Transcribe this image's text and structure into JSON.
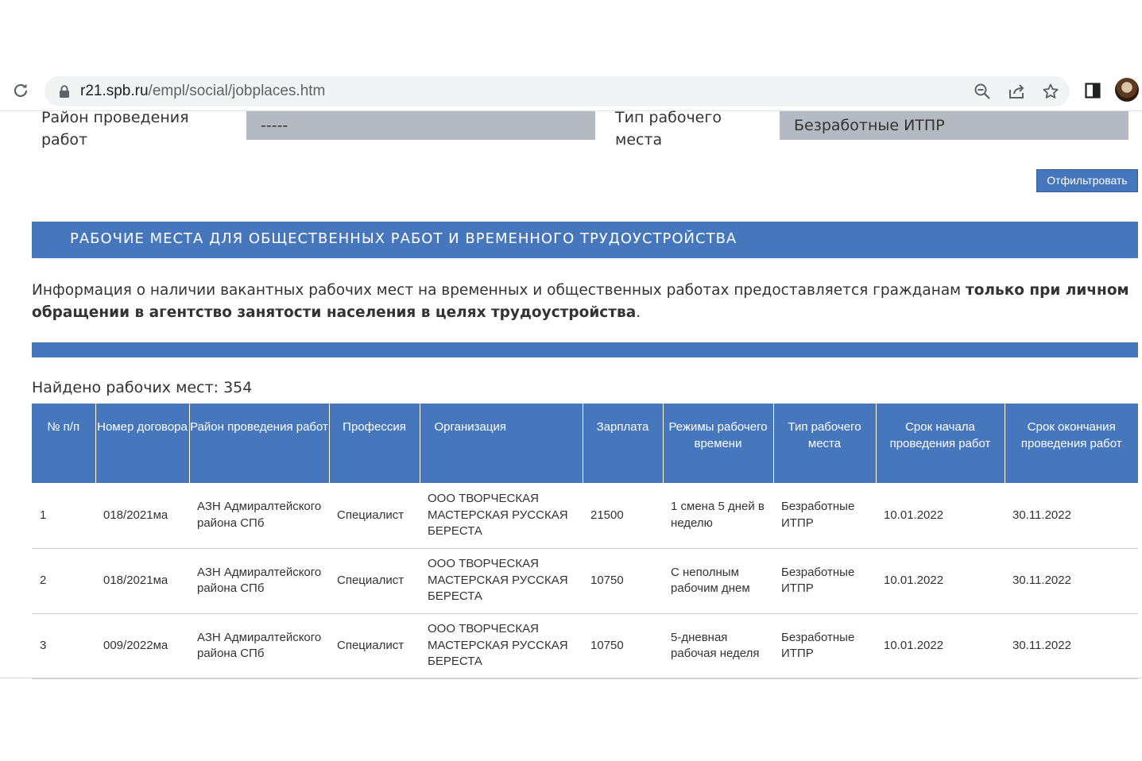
{
  "browser": {
    "url_host": "r21.spb.ru",
    "url_path": "/empl/social/jobplaces.htm",
    "icons": [
      "reload-icon",
      "lock-icon",
      "zoom-icon",
      "share-icon",
      "star-icon",
      "side-panel-icon",
      "avatar"
    ]
  },
  "filters": {
    "district_label": "Район проведения работ",
    "district_value": "-----",
    "place_type_label": "Тип рабочего места",
    "place_type_value": "Безработные ИТПР",
    "filter_button": "Отфильтровать"
  },
  "section": {
    "title": "РАБОЧИЕ МЕСТА ДЛЯ ОБЩЕСТВЕННЫХ РАБОТ И ВРЕМЕННОГО ТРУДОУСТРОЙСТВА",
    "info_text": "Информация о наличии вакантных рабочих мест на временных и общественных работах предоставляется гражданам ",
    "info_bold": "только при личном обращении в агентство занятости населения в целях трудоустройства",
    "info_end": "."
  },
  "found": {
    "label": "Найдено рабочих мест: 354"
  },
  "table": {
    "headers": [
      "№ п/п",
      "Номер договора",
      "Район проведения работ",
      "Профессия",
      "Организация",
      "Зарплата",
      "Режимы рабочего времени",
      "Тип рабочего места",
      "Срок начала проведения работ",
      "Срок окончания проведения работ"
    ],
    "rows": [
      [
        "1",
        "018/2021ма",
        "АЗН Адмиралтейского района СПб",
        "Специалист",
        "ООО ТВОРЧЕСКАЯ МАСТЕРСКАЯ РУССКАЯ БЕРЕСТА",
        "21500",
        "1 смена 5 дней в неделю",
        "Безработные ИТПР",
        "10.01.2022",
        "30.11.2022"
      ],
      [
        "2",
        "018/2021ма",
        "АЗН Адмиралтейского района СПб",
        "Специалист",
        "ООО ТВОРЧЕСКАЯ МАСТЕРСКАЯ РУССКАЯ БЕРЕСТА",
        "10750",
        "С неполным рабочим днем",
        "Безработные ИТПР",
        "10.01.2022",
        "30.11.2022"
      ],
      [
        "3",
        "009/2022ма",
        "АЗН Адмиралтейского района СПб",
        "Специалист",
        "ООО ТВОРЧЕСКАЯ МАСТЕРСКАЯ РУССКАЯ БЕРЕСТА",
        "10750",
        "5-дневная рабочая неделя",
        "Безработные ИТПР",
        "10.01.2022",
        "30.11.2022"
      ]
    ]
  },
  "colors": {
    "accent": "#4677bd",
    "select_bg": "#b5b9c1",
    "text": "#333333"
  }
}
